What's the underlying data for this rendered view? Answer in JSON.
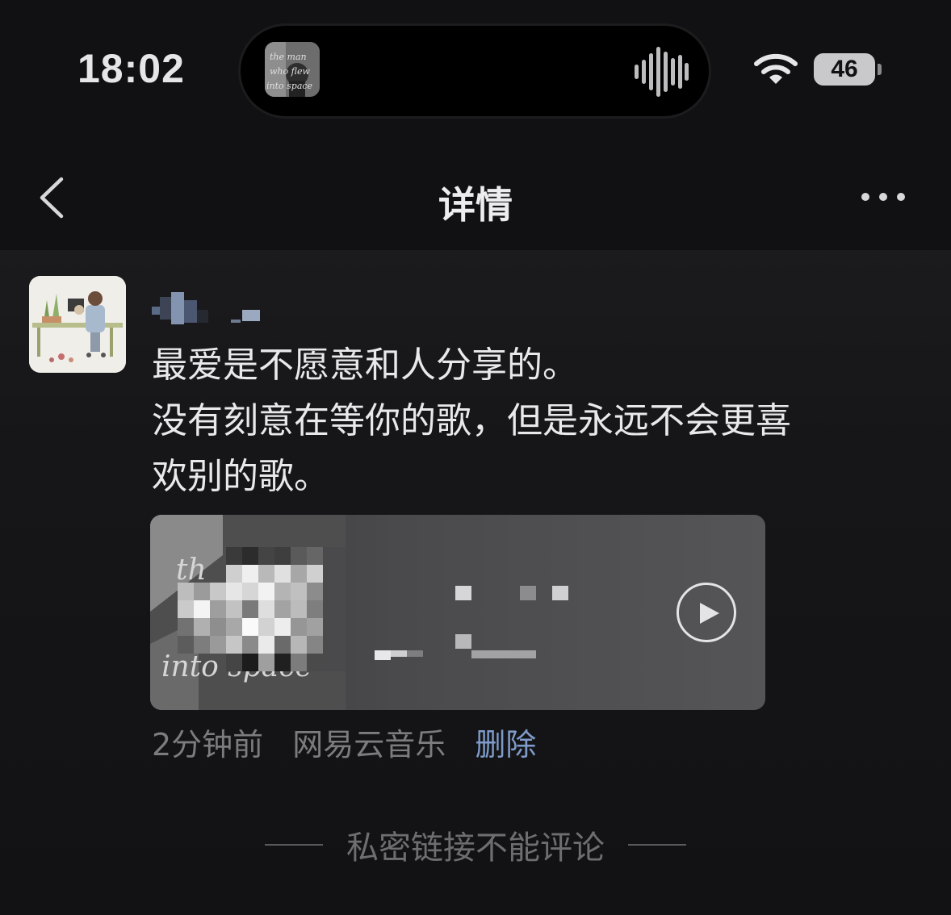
{
  "status_bar": {
    "time": "18:02",
    "battery_level": "46",
    "island_art_text": "the man who flew into space"
  },
  "nav": {
    "title": "详情",
    "back_icon": "chevron-left-icon",
    "more_icon": "ellipsis-icon"
  },
  "post": {
    "username": "",
    "text": "最爱是不愿意和人分享的。\n没有刻意在等你的歌，但是永远不会更喜\n欢别的歌。",
    "music_card": {
      "cover_text": "the man who flew into space",
      "play_icon": "play-circle-icon"
    },
    "meta": {
      "time_ago": "2分钟前",
      "source": "网易云音乐",
      "delete_label": "删除"
    }
  },
  "footer": {
    "note": "私密链接不能评论"
  },
  "colors": {
    "background": "#111113",
    "text_primary": "#e9e9eb",
    "text_secondary": "#7c7c80",
    "link": "#7f9bc9"
  }
}
